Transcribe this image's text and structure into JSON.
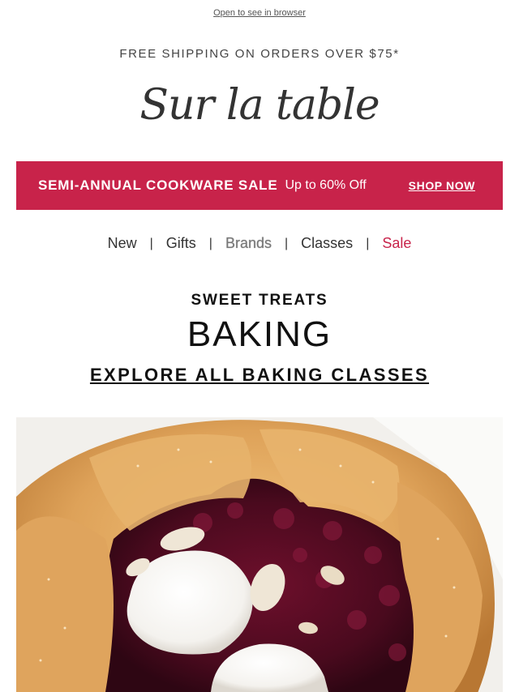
{
  "header": {
    "browser_link": "Open to see in browser",
    "shipping": "FREE SHIPPING ON ORDERS OVER $75*",
    "logo": "Sur la table"
  },
  "banner": {
    "title": "SEMI-ANNUAL COOKWARE SALE",
    "subtitle": "Up to 60% Off",
    "cta": "SHOP NOW",
    "color": "#c8234a"
  },
  "nav": {
    "items": [
      {
        "label": "New"
      },
      {
        "label": "Gifts"
      },
      {
        "label": "Brands"
      },
      {
        "label": "Classes"
      },
      {
        "label": "Sale"
      }
    ],
    "separator": "|"
  },
  "section": {
    "eyebrow": "SWEET TREATS",
    "heading": "BAKING",
    "link": "EXPLORE ALL BAKING CLASSES"
  },
  "hero": {
    "icon": "cherry-galette-image"
  }
}
